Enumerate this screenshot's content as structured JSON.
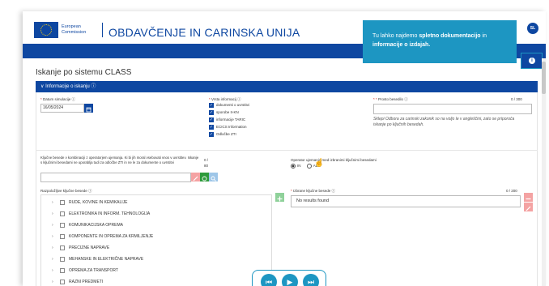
{
  "header": {
    "brand_line1": "European",
    "brand_line2": "Commission",
    "app_title": "OBDAVČENJE IN CARINSKA UNIJA",
    "lang": "SL"
  },
  "tooltip": {
    "text1": "Tu lahko najdemo ",
    "bold1": "spletno dokumentacijo",
    "text2": " in ",
    "bold2": "informacije o izdajah."
  },
  "info_label": "i",
  "page_title": "Iskanje po sistemu CLASS",
  "section_title": "Informacije o iskanju ⓘ",
  "form": {
    "date_label": "Datum simulacije ⓘ",
    "date_value": "16/05/2024",
    "types_label": "Vrsta informacij ⓘ",
    "types": [
      "dokumenti o uvrstitvi",
      "sporobe II-KN",
      "informacije TARIC",
      "ECICS Information",
      "Odločbe ZTI"
    ],
    "free_text_label": "Prosto besedilo ⓘ",
    "free_text_count": "0 / 300",
    "free_text_note": "Sklepi Odbora za carinski zakonik so na voljo le v angleščini, zato se priporoča iskanje po ključnih besedah.",
    "keywords_label": "Ključne besede v kombinaciji z operatorjem ujemanja. Ki bi jih moral vsebovati vnos v uvrstitev. Iskanje s ključnimi besedami ne uporablja tudi za odločbe ZTI in ne le za dokumente o uvrstitvi",
    "keywords_count_top": "0 /",
    "keywords_count_bottom": "80",
    "operator_label": "Operator ujemanja med izbranimi ključnimi besedami",
    "op_and": "IN",
    "op_or": "ALI",
    "available_label": "Razpoložljive ključne besede ⓘ",
    "selected_label": "Izbrane ključne besede ⓘ",
    "selected_count": "0 / 200",
    "no_results": "No results found",
    "tree": [
      "RUDE, KOVINE IN KEMIKALIJE",
      "ELEKTRONIKA IN INFORM. TEHNOLOGIJA",
      "KOMUNIKACIJSKA OPREMA",
      "KOMPONENTE IN OPREMA ZA KRMILJENJE",
      "PRECIZNE NAPRAVE",
      "MEHANSKE IN ELEKTRIČNE NAPRAVE",
      "OPREMA ZA TRANSPORT",
      "RAZNI PREDMETI"
    ]
  },
  "player": {
    "prev": "⏮",
    "play": "▶",
    "next": "⏭"
  }
}
